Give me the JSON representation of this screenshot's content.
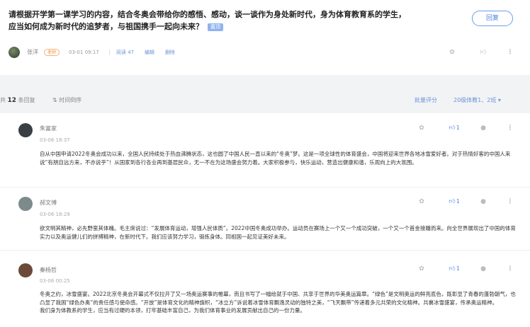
{
  "topic": {
    "title_line1": "请根据开学第一课学习的内容，结合冬奥会带给你的感悟、感动，谈一谈作为身处新时代，身为体育教育系的学生，",
    "title_line2": "应当如何成为新时代的追梦者，与祖国携手一起向未来？",
    "tag": "置顶",
    "reply_label": "回复",
    "author": "张洋",
    "role": "老师",
    "date": "03-01 09:17",
    "views": "阅读 47",
    "edit": "编辑",
    "delete": "删除",
    "icons": [
      "avatar",
      "pin-icon",
      "thumb-up-icon",
      "more-vertical-icon"
    ]
  },
  "toolbar": {
    "total_prefix": "共",
    "total_count": "12",
    "total_suffix": "条回复",
    "sort": "时间倒序",
    "grading": "批量评分",
    "class_select": "20级体教1、2班"
  },
  "comments": [
    {
      "name": "朱富家",
      "date": "03-06 18:37",
      "likes": "1",
      "text": "自从中国申请2022冬奥会成功以来，全国人民持续处于热血沸腾状态，这也圆了中国人民一直以来的“冬奥”梦。这是一项全球性的体育盛会，中国将迎来世界各地冰雪爱好者。对于热情好客的中国人来说“有朋自远方来，不亦说乎”！从国家到各行各业再到基层民众，无一不在为这场盛会努力着。大家积极参与，快乐运动，营造出健康和谐，乐观向上的大氛围。",
      "avatar_color": "#3a3f46"
    },
    {
      "name": "郝文博",
      "date": "03-06 18:29",
      "likes": "1",
      "text": "欲文明其精神，必先野蛮其体魄。毛主席说过：“发展体育运动，增强人民体质”。2022中国冬奥成功举办。运动员在赛场上一个又一个成功突破，一个又一个首金接踵而来。向全世界展现出了中国的体育实力以及奥运健儿们的拼搏精神，在新时代下。我们应该努力学习，锻炼身体。同祖国一起见证美好未来。",
      "avatar_color": "#7d8a8c"
    },
    {
      "name": "秦杨哲",
      "date": "03-06 00:25",
      "likes": "1",
      "text": "冬奥之约，冰雪盛宴。2022北京冬奥会开幕式不仅拉开了又一场奥运赛事的帷幕，而且书写了一幅绘就于中国、共享于世界的华美奥运篇章。“绿色”是文明奥运的鲜亮底色，既彰显了青春的蓬勃朝气，也凸显了我国“绿色办奥”的责任感与使命感。“开放”是体育文化的精神旗帜，“冰立方”诉说着冰雪体育飘逸灵动的独特之美，“飞天飘带”传递着多元共荣的文化精神。共襄冰雪盛宴，传承奥运精神。",
      "text2": "我们身为体教系的学生，应当有过硬的本领，打牢基础丰富自己，为我们体育事业的发展贡献出自己的一份力量。",
      "avatar_color": "#6b4a3a"
    }
  ],
  "colors": {
    "accent": "#4a7fe0",
    "orange_badge": "#e88a2e",
    "background": "#f2f3f5"
  }
}
